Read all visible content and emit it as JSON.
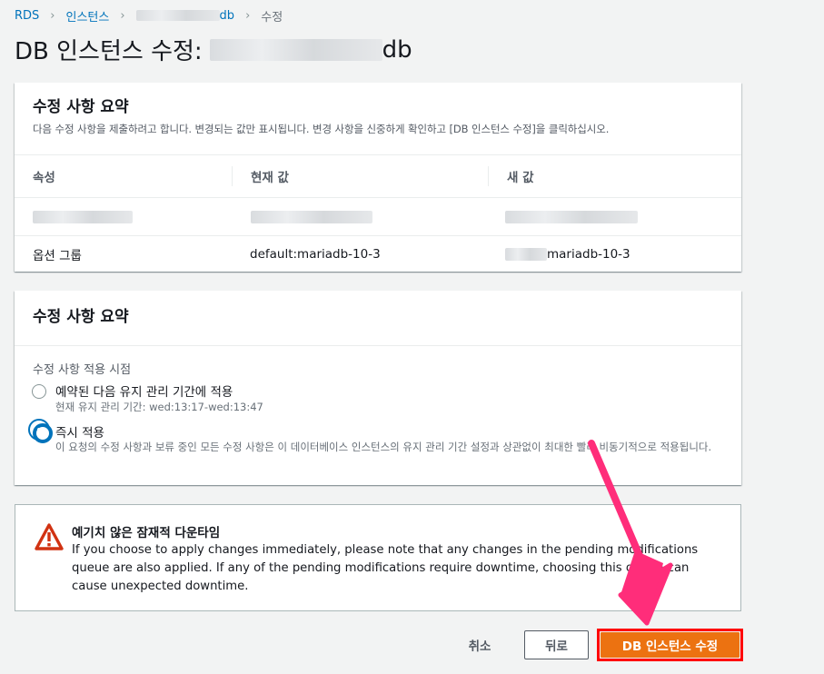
{
  "breadcrumb": {
    "items": [
      "RDS",
      "인스턴스",
      "db",
      "수정"
    ]
  },
  "page": {
    "title_prefix": "DB 인스턴스 수정:",
    "title_suffix": "db"
  },
  "summary_panel": {
    "title": "수정 사항 요약",
    "description": "다음 수정 사항을 제출하려고 합니다. 변경되는 값만 표시됩니다. 변경 사항을 신중하게 확인하고 [DB 인스턴스 수정]을 클릭하십시오.",
    "columns": [
      "속성",
      "현재 값",
      "새 값"
    ],
    "rows": [
      {
        "attribute": "",
        "current": "",
        "new": ""
      },
      {
        "attribute": "옵션 그룹",
        "current": "default:mariadb-10-3",
        "new": "mariadb-10-3"
      }
    ]
  },
  "schedule_panel": {
    "title": "수정 사항 요약",
    "section_label": "수정 사항 적용 시점",
    "options": [
      {
        "label": "예약된 다음 유지 관리 기간에 적용",
        "description": "현재 유지 관리 기간: wed:13:17-wed:13:47",
        "selected": false
      },
      {
        "label": "즉시 적용",
        "description": "이 요청의 수정 사항과 보류 중인 모든 수정 사항은 이 데이터베이스 인스턴스의 유지 관리 기간 설정과 상관없이 최대한 빨리 비동기적으로 적용됩니다.",
        "selected": true
      }
    ]
  },
  "warning": {
    "title": "예기치 않은 잠재적 다운타임",
    "body": "If you choose to apply changes immediately, please note that any changes in the pending modifications queue are also applied. If any of the pending modifications require downtime, choosing this option can cause unexpected downtime.",
    "icon": "warning-triangle-icon",
    "color": "#d13212"
  },
  "actions": {
    "cancel_label": "취소",
    "back_label": "뒤로",
    "submit_label": "DB 인스턴스 수정"
  },
  "colors": {
    "link": "#0073bb",
    "primary": "#ec7211",
    "highlight": "#ff0000",
    "arrow": "#ff2d7a"
  }
}
